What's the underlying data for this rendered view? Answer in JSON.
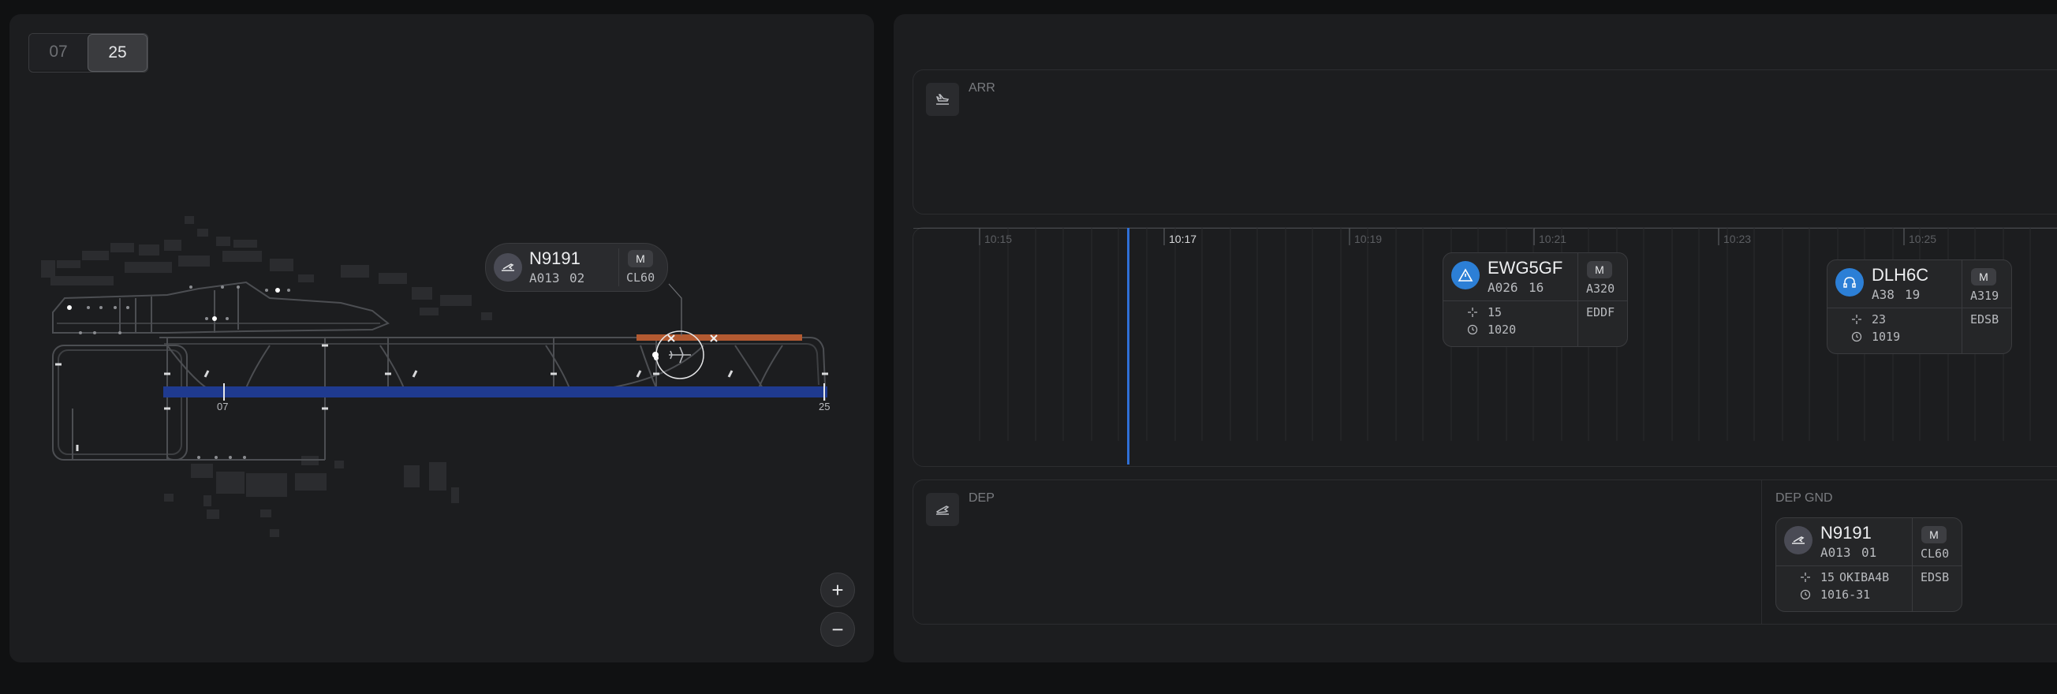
{
  "map": {
    "runway_buttons": [
      {
        "label": "07",
        "active": false
      },
      {
        "label": "25",
        "active": true
      }
    ],
    "runway_ends": [
      "07",
      "25"
    ],
    "zoom_in_label": "+",
    "zoom_out_label": "−",
    "flight_tag": {
      "callsign": "N9191",
      "gate": "A013",
      "seq": "02",
      "wake": "M",
      "aircraft": "CL60",
      "icon": "departure-plane-icon"
    }
  },
  "timeline": {
    "sections": {
      "arr": {
        "label": "ARR",
        "icon": "landing-plane-icon"
      },
      "dep": {
        "label": "DEP",
        "icon": "takeoff-plane-icon"
      },
      "dep_gnd": {
        "label": "DEP GND"
      }
    },
    "ticks": [
      {
        "label": "10:15",
        "bright": false
      },
      {
        "label": "10:17",
        "bright": true
      },
      {
        "label": "10:19",
        "bright": false
      },
      {
        "label": "10:21",
        "bright": false
      },
      {
        "label": "10:23",
        "bright": false
      },
      {
        "label": "10:25",
        "bright": false
      }
    ],
    "now_line_color": "#2f6fd6",
    "cards": [
      {
        "callsign": "EWG5GF",
        "gate": "A026",
        "seq": "16",
        "wake": "M",
        "aircraft": "A320",
        "runway_hold": "15",
        "time": "1020",
        "dest": "EDDF",
        "icon": "alert-triangle-icon",
        "icon_color": "#2c7fd6"
      },
      {
        "callsign": "DLH6C",
        "gate": "A38",
        "seq": "19",
        "wake": "M",
        "aircraft": "A319",
        "runway_hold": "23",
        "time": "1019",
        "dest": "EDSB",
        "icon": "headset-icon",
        "icon_color": "#2c7fd6"
      },
      {
        "callsign": "N9191",
        "gate": "A013",
        "seq": "01",
        "wake": "M",
        "aircraft": "CL60",
        "runway_hold": "15",
        "sid": "OKIBA4B",
        "time": "1016-31",
        "dest": "EDSB",
        "icon": "departure-plane-icon",
        "icon_color": "#4a4b55"
      }
    ]
  }
}
